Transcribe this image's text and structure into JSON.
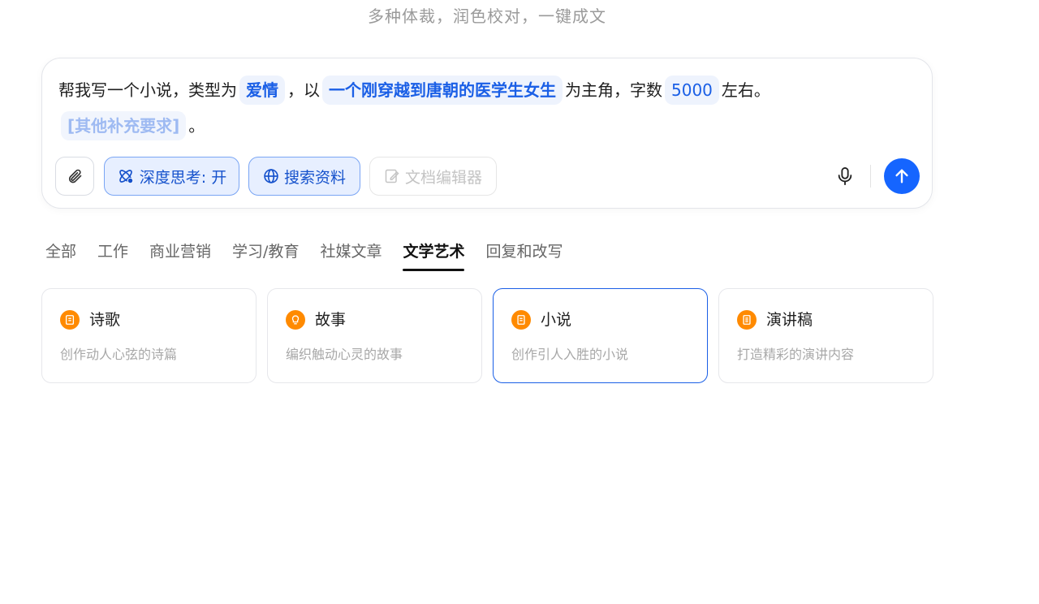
{
  "header": {
    "subtitle": "多种体裁，润色校对，一键成文"
  },
  "composer": {
    "text_1": "帮我写一个小说，类型为",
    "slot_genre": "爱情",
    "text_2": "，以",
    "slot_protagonist": "一个刚穿越到唐朝的医学生女生",
    "text_3": "为主角，字数",
    "slot_words": "5000",
    "text_4": "左右。",
    "slot_extra": "[其他补充要求]",
    "text_5": "。",
    "deep_think_label": "深度思考: 开",
    "search_label": "搜索资料",
    "doc_editor_label": "文档编辑器"
  },
  "tabs": [
    {
      "label": "全部"
    },
    {
      "label": "工作"
    },
    {
      "label": "商业营销"
    },
    {
      "label": "学习/教育"
    },
    {
      "label": "社媒文章"
    },
    {
      "label": "文学艺术",
      "active": true
    },
    {
      "label": "回复和改写"
    }
  ],
  "cards": [
    {
      "title": "诗歌",
      "desc": "创作动人心弦的诗篇",
      "icon": "poem-icon"
    },
    {
      "title": "故事",
      "desc": "编织触动心灵的故事",
      "icon": "lightbulb-icon"
    },
    {
      "title": "小说",
      "desc": "创作引人入胜的小说",
      "icon": "book-icon",
      "selected": true
    },
    {
      "title": "演讲稿",
      "desc": "打造精彩的演讲内容",
      "icon": "document-icon"
    }
  ],
  "colors": {
    "accent": "#1565ff",
    "card_icon": "#ff8a00",
    "slot_text": "#1a5fe6"
  }
}
